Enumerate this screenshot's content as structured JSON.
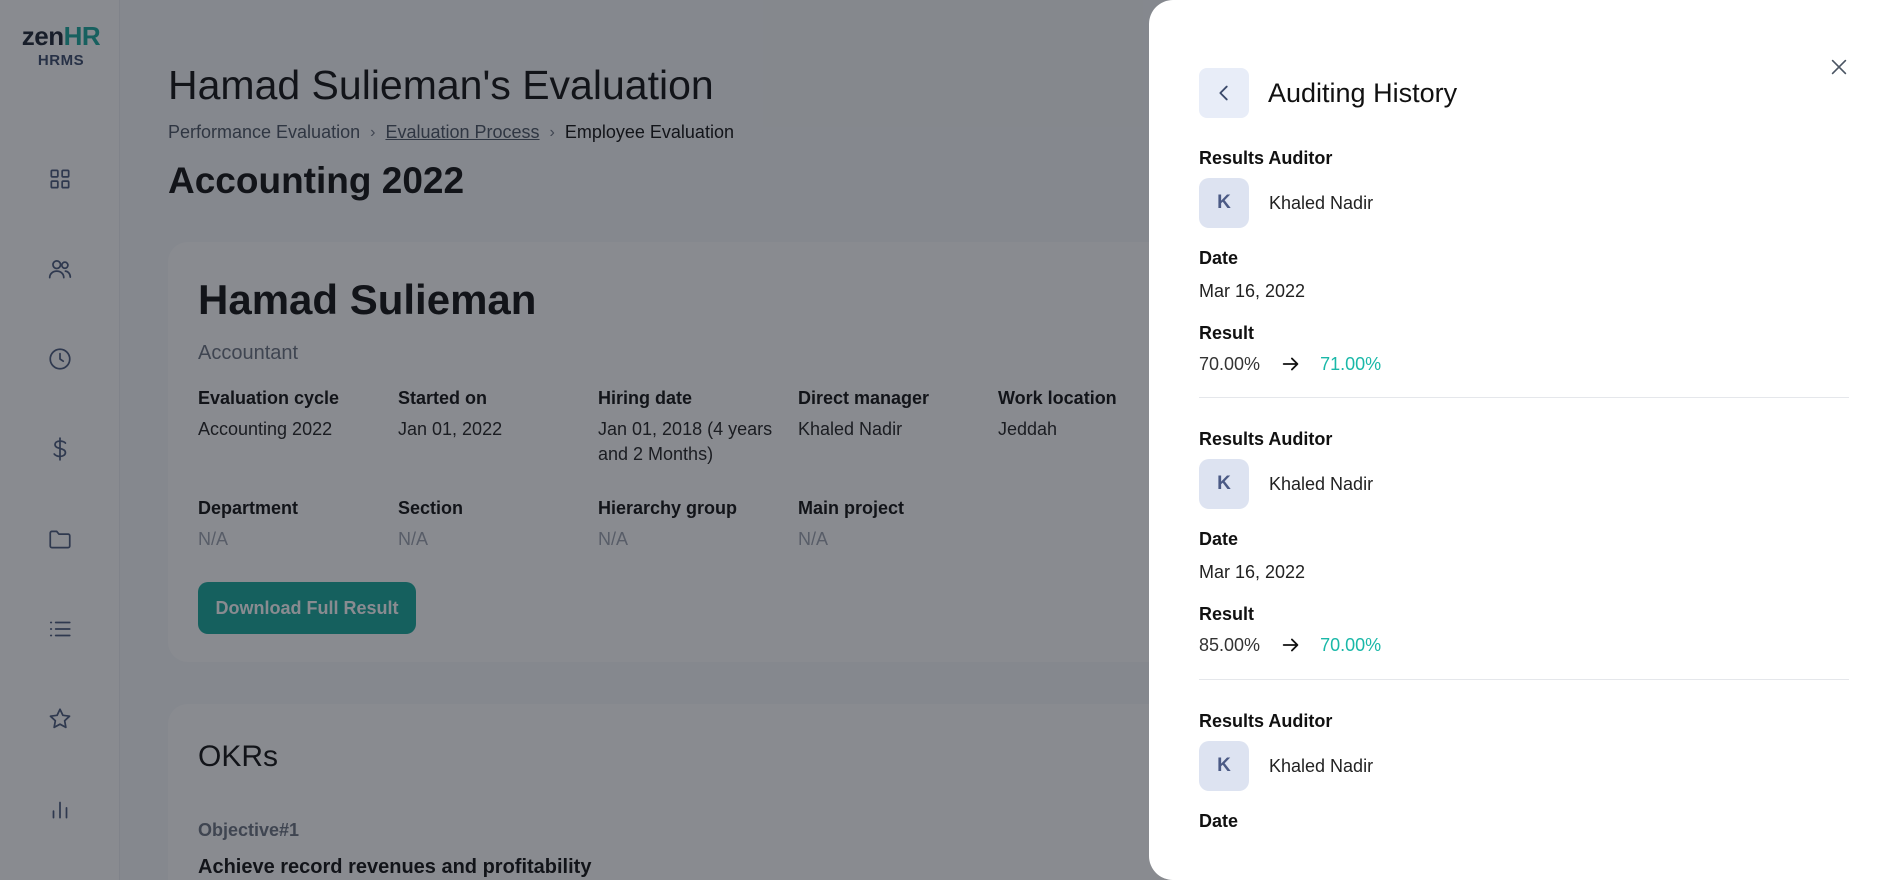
{
  "logo": {
    "brand_a": "zen",
    "brand_b": "HR",
    "sub": "HRMS"
  },
  "sidebar": {
    "icons": [
      "dashboard-icon",
      "people-icon",
      "clock-icon",
      "dollar-icon",
      "folder-icon",
      "list-icon",
      "star-icon",
      "bar-chart-icon"
    ]
  },
  "header": {
    "title": "Hamad Sulieman's Evaluation",
    "breadcrumb": {
      "item1": "Performance Evaluation",
      "item2": "Evaluation Process",
      "item3": "Employee Evaluation"
    },
    "cycle_title": "Accounting 2022"
  },
  "employee": {
    "name": "Hamad Sulieman",
    "role": "Accountant",
    "fields": {
      "evaluation_cycle": {
        "label": "Evaluation cycle",
        "value": "Accounting 2022"
      },
      "started_on": {
        "label": "Started on",
        "value": "Jan 01, 2022"
      },
      "hiring_date": {
        "label": "Hiring date",
        "value": "Jan 01, 2018 (4 years and 2 Months)"
      },
      "direct_manager": {
        "label": "Direct manager",
        "value": "Khaled Nadir"
      },
      "work_location": {
        "label": "Work location",
        "value": "Jeddah"
      },
      "department": {
        "label": "Department",
        "value": "N/A"
      },
      "section": {
        "label": "Section",
        "value": "N/A"
      },
      "hierarchy_group": {
        "label": "Hierarchy group",
        "value": "N/A"
      },
      "main_project": {
        "label": "Main project",
        "value": "N/A"
      }
    },
    "download_label": "Download Full Result"
  },
  "okrs": {
    "title": "OKRs",
    "objective_label": "Objective#1",
    "objective_text": "Achieve record revenues and profitability"
  },
  "drawer": {
    "title": "Auditing History",
    "labels": {
      "auditor": "Results Auditor",
      "date": "Date",
      "result": "Result"
    },
    "entries": [
      {
        "initial": "K",
        "auditor": "Khaled Nadir",
        "date": "Mar 16, 2022",
        "old": "70.00%",
        "new": "71.00%"
      },
      {
        "initial": "K",
        "auditor": "Khaled Nadir",
        "date": "Mar 16, 2022",
        "old": "85.00%",
        "new": "70.00%"
      },
      {
        "initial": "K",
        "auditor": "Khaled Nadir"
      }
    ]
  },
  "colors": {
    "accent": "#17a89a",
    "new_value": "#1ab8a8",
    "overlay": "rgba(20,24,33,0.5)"
  }
}
